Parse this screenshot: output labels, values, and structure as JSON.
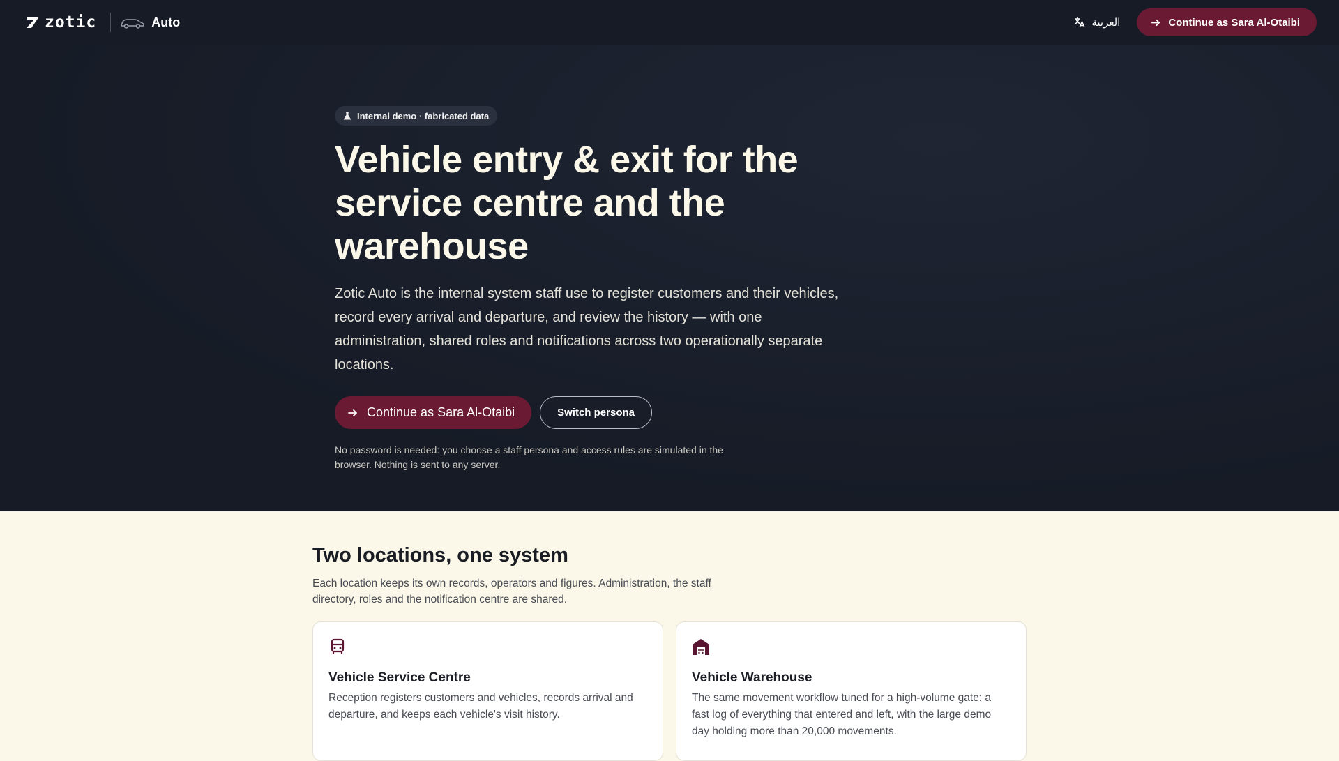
{
  "header": {
    "brand": "zotic",
    "product": "Auto",
    "language_label": "العربية",
    "cta_label": "Continue as Sara Al-Otaibi"
  },
  "hero": {
    "badge": "Internal demo · fabricated data",
    "title": "Vehicle entry & exit for the service centre and the warehouse",
    "description": "Zotic Auto is the internal system staff use to register customers and their vehicles, record every arrival and departure, and review the history — with one administration, shared roles and notifications across two operationally separate locations.",
    "primary_label": "Continue as Sara Al-Otaibi",
    "secondary_label": "Switch persona",
    "note": "No password is needed: you choose a staff persona and access rules are simulated in the browser. Nothing is sent to any server."
  },
  "locations": {
    "title": "Two locations, one system",
    "description": "Each location keeps its own records, operators and figures. Administration, the staff directory, roles and the notification centre are shared.",
    "cards": [
      {
        "icon": "car-front-icon",
        "title": "Vehicle Service Centre",
        "description": "Reception registers customers and vehicles, records arrival and departure, and keeps each vehicle's visit history."
      },
      {
        "icon": "warehouse-icon",
        "title": "Vehicle Warehouse",
        "description": "The same movement workflow tuned for a high-volume gate: a fast log of everything that entered and left, with the large demo day holding more than 20,000 movements."
      }
    ]
  },
  "colors": {
    "accent": "#6b1a34",
    "hero_bg": "#161b26",
    "page_bg": "#fbf8ea"
  }
}
